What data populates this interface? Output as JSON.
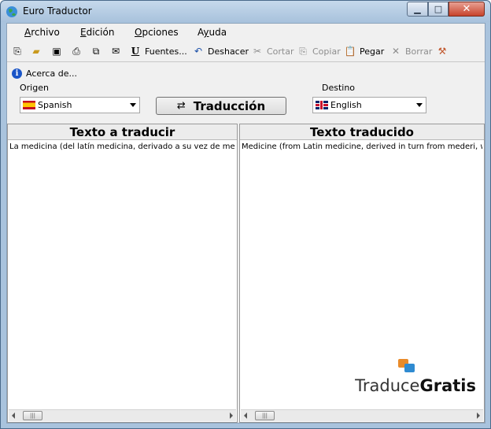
{
  "window": {
    "title": "Euro Traductor",
    "icon": "globe-icon",
    "controls": {
      "minimize": "▁",
      "maximize": "□",
      "close": "✕"
    }
  },
  "menubar": [
    {
      "pre": "",
      "u": "A",
      "post": "rchivo"
    },
    {
      "pre": "",
      "u": "E",
      "post": "dición"
    },
    {
      "pre": "",
      "u": "O",
      "post": "pciones"
    },
    {
      "pre": "A",
      "u": "y",
      "post": "uda"
    }
  ],
  "toolbar": {
    "fonts_label": "Fuentes...",
    "undo_label": "Deshacer",
    "cut_label": "Cortar",
    "copy_label": "Copiar",
    "paste_label": "Pegar",
    "delete_label": "Borrar"
  },
  "about_label": "Acerca de...",
  "source": {
    "label": "Origen",
    "language": "Spanish"
  },
  "target": {
    "label": "Destino",
    "language": "English"
  },
  "translate_button": "Traducción",
  "input_panel": {
    "title": "Texto a traducir",
    "text": "La medicina (del latín medicina, derivado a su vez de mederi,"
  },
  "output_panel": {
    "title": "Texto traducido",
    "text": "Medicine (from Latin medicine, derived in turn from mederi, whic"
  },
  "logo": {
    "part1": "Traduce",
    "part2": "Gratis"
  }
}
